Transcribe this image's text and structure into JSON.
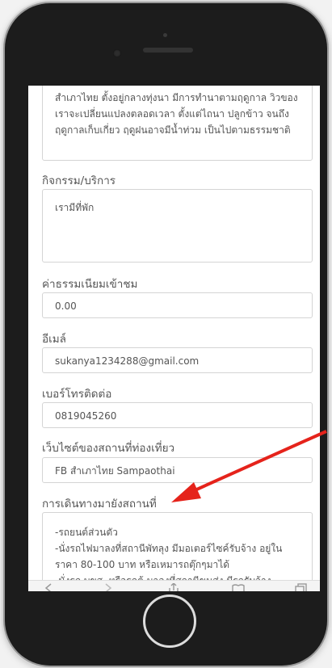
{
  "form": {
    "description_text": "สำเภาไทย ตั้งอยู่กลางทุ่งนา มีการทำนาตามฤดูกาล วิวของเราจะเปลี่ยนแปลงตลอดเวลา ตั้งแต่ไถนา ปลูกข้าว จนถึงฤดูกาลเก็บเกี่ยว ฤดูฝนอาจมีน้ำท่วม เป็นไปตามธรรมชาติ",
    "activities_label": "กิจกรรม/บริการ",
    "activities_value": "เรามีที่พัก",
    "fee_label": "ค่าธรรมเนียมเข้าชม",
    "fee_value": "0.00",
    "email_label": "อีเมล์",
    "email_value": "sukanya1234288@gmail.com",
    "phone_label": "เบอร์โทรติดต่อ",
    "phone_value": "0819045260",
    "website_label": "เว็บไซต์ของสถานที่ท่องเที่ยว",
    "website_value": "FB สำเภาไทย Sampaothai",
    "directions_label": "การเดินทางมายังสถานที่",
    "directions_text": "-รถยนต์ส่วนตัว\n-นั่งรถไฟมาลงที่สถานีพัทลุง มีมอเตอร์ไซค์รับจ้าง อยู่ในราคา 80-100 บาท หรือเหมารถตุ๊กๆมาได้\n-นั่งรถ บขส. หรือรถตู้ มาลงที่สถานีขนส่ง มีรถรับจ้าง"
  },
  "annotation": {
    "arrow_color": "#e5231b"
  },
  "device": {
    "frame_color": "#1c1c1c"
  }
}
